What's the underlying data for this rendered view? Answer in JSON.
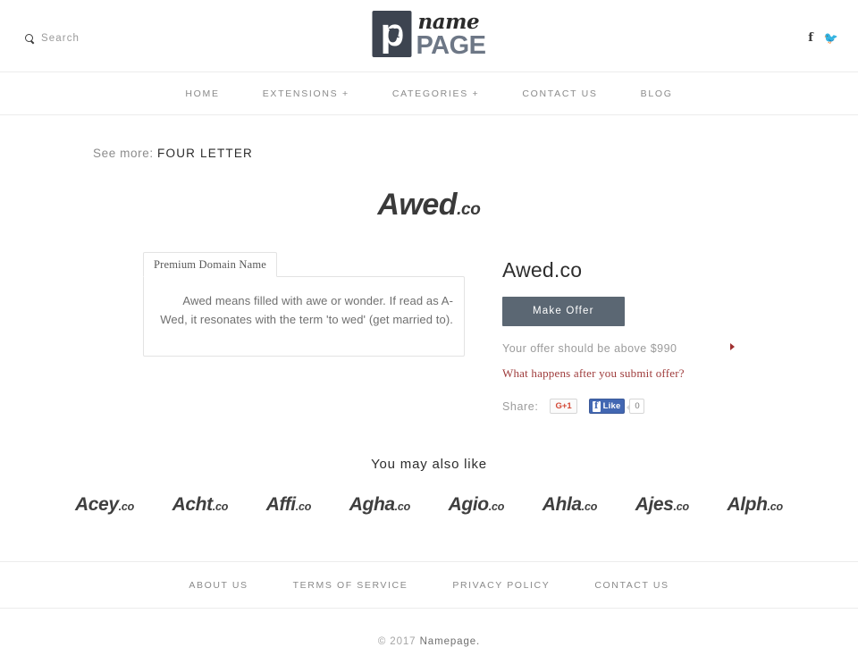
{
  "header": {
    "search": {
      "label": "Search",
      "icon": "search-icon"
    },
    "logo": {
      "mark_letter": "p",
      "mark_script": "n",
      "name": "name",
      "page": "PAGE"
    },
    "social": [
      {
        "name": "facebook-icon",
        "glyph": "f"
      },
      {
        "name": "twitter-icon",
        "glyph": "🐦"
      }
    ]
  },
  "nav": {
    "items": [
      {
        "label": "HOME"
      },
      {
        "label": "EXTENSIONS +"
      },
      {
        "label": "CATEGORIES +"
      },
      {
        "label": "CONTACT US"
      },
      {
        "label": "BLOG"
      }
    ]
  },
  "main": {
    "see_more_prefix": "See more:",
    "see_more_category": "FOUR LETTER",
    "domain_name": "Awed",
    "domain_tld": ".co",
    "description": {
      "tab_label": "Premium Domain Name",
      "text": "Awed means filled with awe or wonder. If read as A-Wed, it resonates with the term 'to wed' (get married to)."
    },
    "offer": {
      "title": "Awed.co",
      "button_label": "Make Offer",
      "note": "Your offer should be above $990",
      "link_label": "What happens after you submit offer?",
      "share_label": "Share:",
      "gplus_label": "G+1",
      "fb_like_label": "Like",
      "fb_count": "0"
    }
  },
  "also_like": {
    "title": "You may also like",
    "items": [
      {
        "name": "Acey",
        "tld": ".co"
      },
      {
        "name": "Acht",
        "tld": ".co"
      },
      {
        "name": "Affi",
        "tld": ".co"
      },
      {
        "name": "Agha",
        "tld": ".co"
      },
      {
        "name": "Agio",
        "tld": ".co"
      },
      {
        "name": "Ahla",
        "tld": ".co"
      },
      {
        "name": "Ajes",
        "tld": ".co"
      },
      {
        "name": "Alph",
        "tld": ".co"
      }
    ]
  },
  "footer": {
    "links": [
      {
        "label": "ABOUT US"
      },
      {
        "label": "TERMS OF SERVICE"
      },
      {
        "label": "PRIVACY POLICY"
      },
      {
        "label": "CONTACT US"
      }
    ],
    "copyright_prefix": "© 2017",
    "copyright_brand": "Namepage."
  },
  "colors": {
    "button": "#5b6773",
    "link_red": "#9e3b3b",
    "logo_dark": "#3d4450",
    "logo_gray": "#6d7786"
  }
}
